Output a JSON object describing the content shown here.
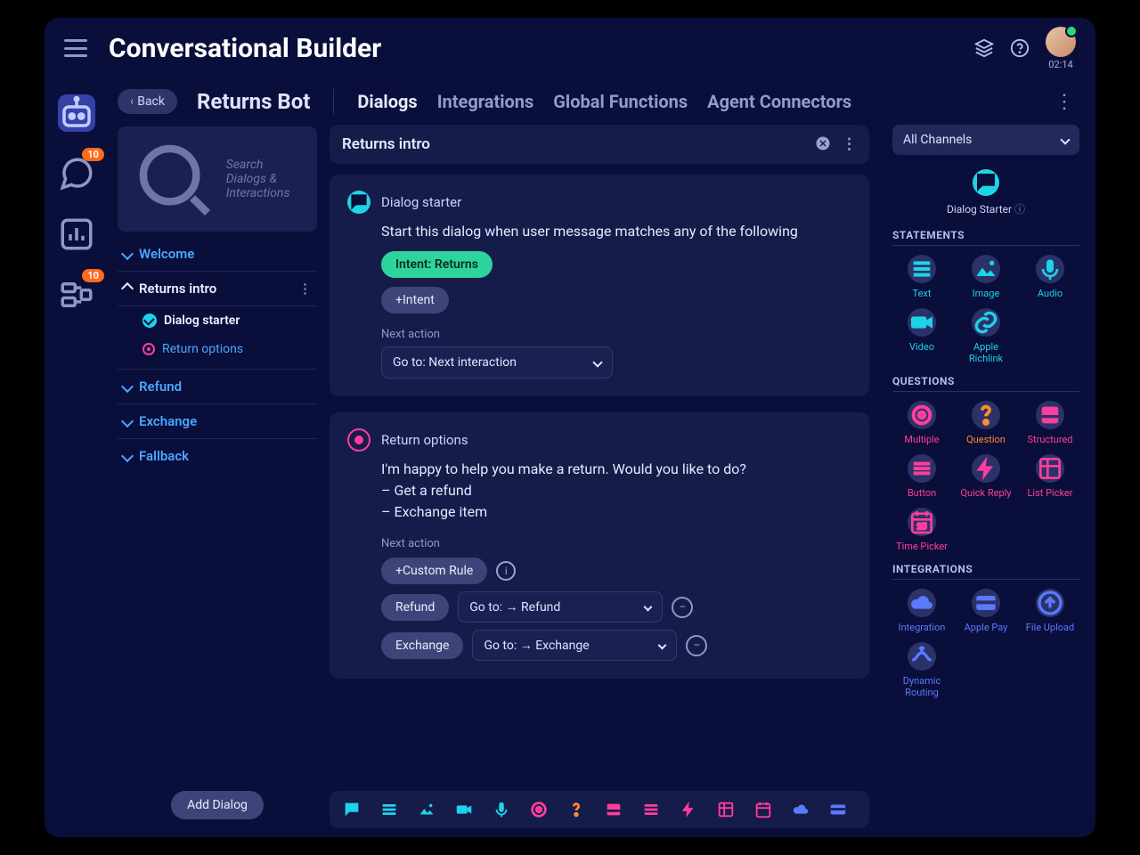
{
  "app": {
    "title": "Conversational Builder",
    "timer": "02:14"
  },
  "rail": {
    "badge_chat": "10",
    "badge_flow": "10"
  },
  "back_label": "Back",
  "bot_name": "Returns Bot",
  "tabs": {
    "dialogs": "Dialogs",
    "integrations": "Integrations",
    "global_functions": "Global Functions",
    "agent_connectors": "Agent Connectors"
  },
  "search_placeholder": "Search Dialogs & Interactions",
  "dialogs": {
    "welcome": "Welcome",
    "returns_intro": "Returns intro",
    "returns_starter": "Dialog starter",
    "returns_options": "Return options",
    "refund": "Refund",
    "exchange": "Exchange",
    "fallback": "Fallback"
  },
  "add_dialog_label": "Add Dialog",
  "canvas": {
    "title": "Returns intro",
    "starter_title": "Dialog starter",
    "starter_text": "Start this dialog when user message matches any of the following",
    "intent_chip": "Intent: Returns",
    "add_intent": "+Intent",
    "next_action_label": "Next action",
    "next_action_value": "Go to: Next interaction",
    "options_title": "Return options",
    "options_text_l1": "I'm happy to help you make a return. Would you like to do?",
    "options_text_l2": "– Get a refund",
    "options_text_l3": "– Exchange item",
    "custom_rule": "+Custom Rule",
    "rule_refund": "Refund",
    "rule_refund_goto": "Go to: → Refund",
    "rule_exchange": "Exchange",
    "rule_exchange_goto": "Go to: → Exchange"
  },
  "panel": {
    "channel": "All Channels",
    "dialog_starter": "Dialog Starter",
    "sections": {
      "statements": "STATEMENTS",
      "questions": "QUESTIONS",
      "integrations": "INTEGRATIONS"
    },
    "statements": {
      "text": "Text",
      "image": "Image",
      "audio": "Audio",
      "video": "Video",
      "apple_richlink": "Apple Richlink"
    },
    "questions": {
      "multiple": "Multiple",
      "question": "Question",
      "structured": "Structured",
      "button": "Button",
      "quick_reply": "Quick Reply",
      "list_picker": "List Picker",
      "time_picker": "Time Picker"
    },
    "integrations": {
      "integration": "Integration",
      "apple_pay": "Apple Pay",
      "file_upload": "File Upload",
      "dynamic_routing": "Dynamic Routing"
    }
  }
}
